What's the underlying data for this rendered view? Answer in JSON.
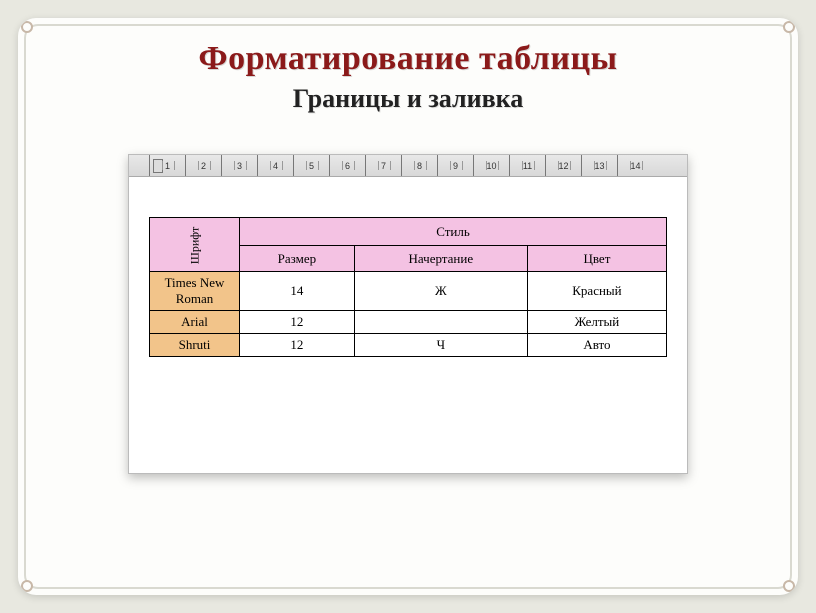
{
  "title": "Форматирование таблицы",
  "subtitle": "Границы и заливка",
  "ruler_numbers": [
    "1",
    "2",
    "3",
    "4",
    "5",
    "6",
    "7",
    "8",
    "9",
    "10",
    "11",
    "12",
    "13",
    "14"
  ],
  "table": {
    "head_font": "Шрифт",
    "head_style": "Стиль",
    "subheads": [
      "Размер",
      "Начертание",
      "Цвет"
    ],
    "rows": [
      {
        "font": "Times New Roman",
        "size": "14",
        "weight": "Ж",
        "color": "Красный"
      },
      {
        "font": "Arial",
        "size": "12",
        "weight": "",
        "color": "Желтый"
      },
      {
        "font": "Shruti",
        "size": "12",
        "weight": "Ч",
        "color": "Авто"
      }
    ]
  }
}
